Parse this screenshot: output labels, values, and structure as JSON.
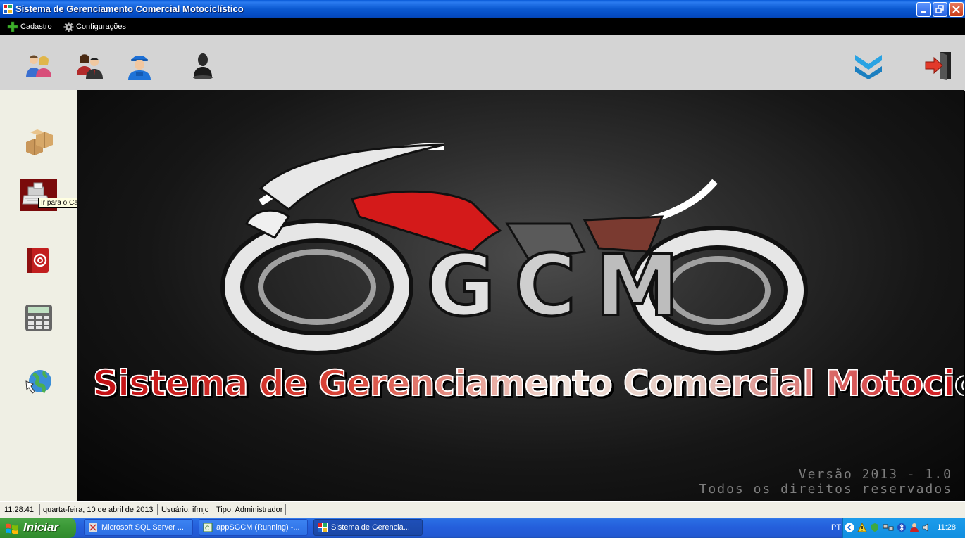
{
  "window": {
    "title": "Sistema de Gerenciamento Comercial Motociclístico"
  },
  "menu": [
    {
      "label": "Cadastro",
      "icon": "plus-icon"
    },
    {
      "label": "Configurações",
      "icon": "gear-icon"
    }
  ],
  "toolbar": {
    "left_icons": [
      "clients-icon",
      "employees-icon",
      "worker-icon",
      "user-silhouette-icon"
    ],
    "right_icons": [
      "email-icon",
      "exit-icon"
    ]
  },
  "sidebar": {
    "icons": [
      "products-box-icon",
      "cash-register-icon",
      "address-book-icon",
      "calculator-icon",
      "internet-globe-icon"
    ],
    "tooltip": "Ir para o Caixa"
  },
  "splash": {
    "logo_text": "SGCM",
    "banner": "Sistema de Gerenciamento Comercial Motociclístico",
    "version_line1": "Versão 2013 - 1.0",
    "version_line2": "Todos os direitos reservados"
  },
  "statusbar": {
    "time": "11:28:41",
    "date": "quarta-feira, 10 de abril de 2013",
    "user": "Usuário: ifrnjc",
    "type": "Tipo: Administrador"
  },
  "taskbar": {
    "start_label": "Iniciar",
    "tasks": [
      {
        "label": "Microsoft SQL Server ...",
        "active": false
      },
      {
        "label": "appSGCM (Running) -...",
        "active": false
      },
      {
        "label": "Sistema de Gerencia...",
        "active": true
      }
    ],
    "language": "PT",
    "clock": "11:28"
  },
  "colors": {
    "title_bar": "#0a58d0",
    "taskbar": "#245edb",
    "start_green": "#3c9a38",
    "brand_red": "#c30d12"
  }
}
